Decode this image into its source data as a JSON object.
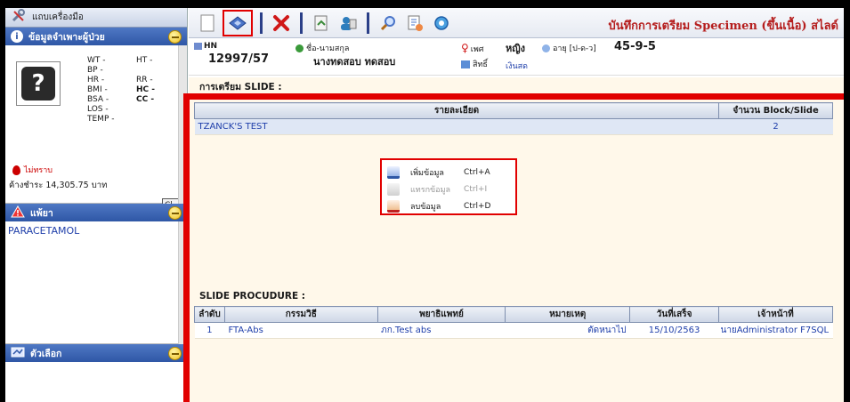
{
  "sidebar": {
    "toolbox_title": "แถบเครื่องมือ",
    "patient_panel_title": "ข้อมูลจำเพาะผู้ป่วย",
    "vitals": [
      {
        "a": "WT -",
        "b": "HT -"
      },
      {
        "a": "BP -",
        "b": ""
      },
      {
        "a": "HR -",
        "b": "RR -"
      },
      {
        "a": "BMI -",
        "b": "HC -"
      },
      {
        "a": "BSA -",
        "b": "CC -"
      },
      {
        "a": "LOS -",
        "b": ""
      },
      {
        "a": "TEMP -",
        "b": ""
      }
    ],
    "blood_group": "ไม่ทราบ",
    "debt": "ค้างชำระ 14,305.75 บาท",
    "cl_button": "Cl",
    "allergy_panel_title": "แพ้ยา",
    "allergy_items": [
      "PARACETAMOL"
    ],
    "options_panel_title": "ตัวเลือก"
  },
  "toolbar": {
    "title": "บันทึกการเตรียม Specimen (ขึ้นเนื้อ) สไลด์"
  },
  "patient": {
    "hn_label": "HN",
    "hn_value": "12997/57",
    "name_label": "ชื่อ-นามสกุล",
    "name_value": "นางทดสอบ ทดสอบ",
    "sex_label": "เพศ",
    "sex_value": "หญิง",
    "rights_label": "สิทธิ์",
    "rights_value": "เงินสด",
    "age_label": "อายุ [ป-ด-ว]",
    "age_value": "45-9-5"
  },
  "slide_section": {
    "title": "การเตรียม SLIDE :",
    "columns": [
      "รายละเอียด",
      "จำนวน Block/Slide"
    ],
    "rows": [
      {
        "detail": "TZANCK'S TEST",
        "count": "2"
      }
    ]
  },
  "context_menu": {
    "items": [
      {
        "label": "เพิ่มข้อมูล",
        "shortcut": "Ctrl+A",
        "enabled": true
      },
      {
        "label": "แทรกข้อมูล",
        "shortcut": "Ctrl+I",
        "enabled": false
      },
      {
        "label": "ลบข้อมูล",
        "shortcut": "Ctrl+D",
        "enabled": true
      }
    ]
  },
  "procedure_section": {
    "title": "SLIDE PROCUDURE :",
    "columns": [
      "ลำดับ",
      "กรรมวิธี",
      "พยาธิแพทย์",
      "หมายเหตุ",
      "วันที่เสร็จ",
      "เจ้าหน้าที่"
    ],
    "rows": [
      {
        "no": "1",
        "method": "FTA-Abs",
        "pathologist": "ภก.Test abs",
        "note": "ตัดหนาไป",
        "date": "15/10/2563",
        "staff": "นายAdministrator F7SQL"
      }
    ]
  }
}
